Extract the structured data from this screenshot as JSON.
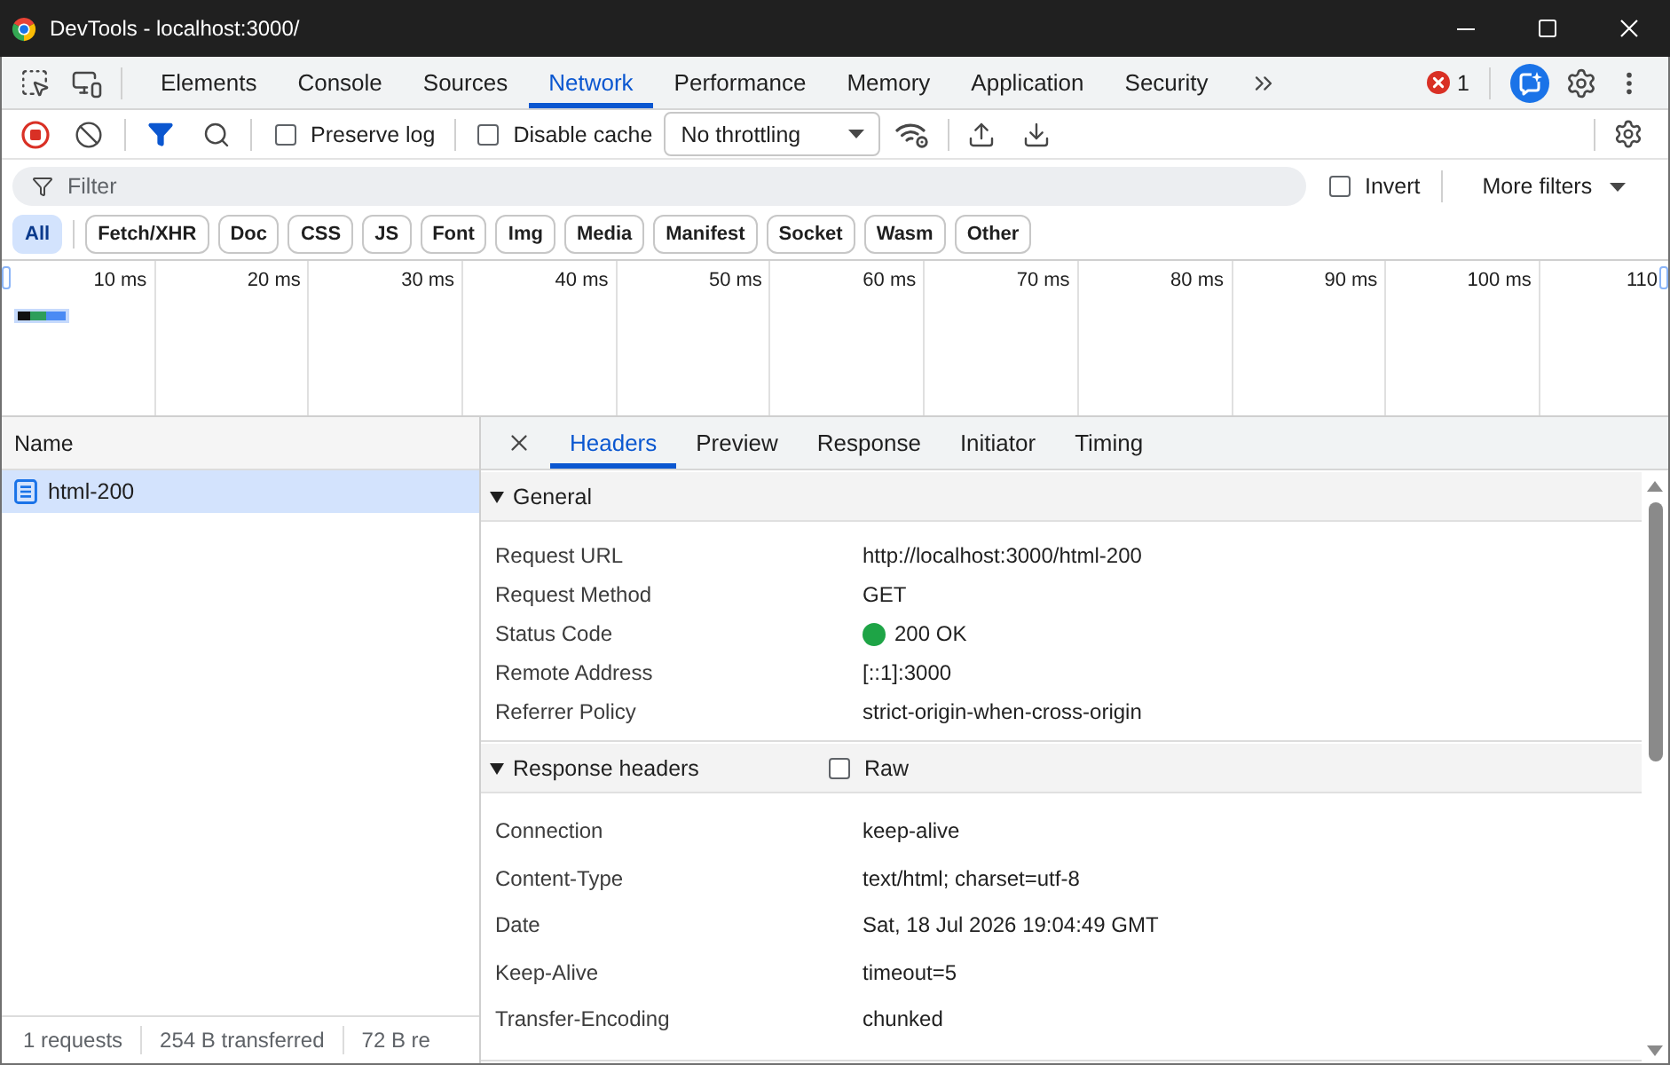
{
  "window": {
    "title": "DevTools - localhost:3000/"
  },
  "panel_tabs": [
    {
      "label": "Elements",
      "selected": false
    },
    {
      "label": "Console",
      "selected": false
    },
    {
      "label": "Sources",
      "selected": false
    },
    {
      "label": "Network",
      "selected": true
    },
    {
      "label": "Performance",
      "selected": false
    },
    {
      "label": "Memory",
      "selected": false
    },
    {
      "label": "Application",
      "selected": false
    },
    {
      "label": "Security",
      "selected": false
    }
  ],
  "error_count": "1",
  "toolbar": {
    "recording": true,
    "filter_shown": true,
    "preserve_log": {
      "label": "Preserve log",
      "checked": false
    },
    "disable_cache": {
      "label": "Disable cache",
      "checked": false
    },
    "throttling": {
      "value": "No throttling"
    }
  },
  "filter_bar": {
    "placeholder": "Filter",
    "invert": {
      "label": "Invert",
      "checked": false
    },
    "more_filters": "More filters"
  },
  "type_filters": [
    {
      "label": "All",
      "selected": true
    },
    {
      "label": "Fetch/XHR",
      "selected": false
    },
    {
      "label": "Doc",
      "selected": false
    },
    {
      "label": "CSS",
      "selected": false
    },
    {
      "label": "JS",
      "selected": false
    },
    {
      "label": "Font",
      "selected": false
    },
    {
      "label": "Img",
      "selected": false
    },
    {
      "label": "Media",
      "selected": false
    },
    {
      "label": "Manifest",
      "selected": false
    },
    {
      "label": "Socket",
      "selected": false
    },
    {
      "label": "Wasm",
      "selected": false
    },
    {
      "label": "Other",
      "selected": false
    }
  ],
  "overview": {
    "ticks": [
      "10 ms",
      "20 ms",
      "30 ms",
      "40 ms",
      "50 ms",
      "60 ms",
      "70 ms",
      "80 ms",
      "90 ms",
      "100 ms",
      "110"
    ]
  },
  "requests": {
    "column": "Name",
    "rows": [
      {
        "name": "html-200",
        "selected": true
      }
    ]
  },
  "status_bar": [
    "1 requests",
    "254 B transferred",
    "72 B re"
  ],
  "detail_tabs": [
    {
      "label": "Headers",
      "selected": true
    },
    {
      "label": "Preview",
      "selected": false
    },
    {
      "label": "Response",
      "selected": false
    },
    {
      "label": "Initiator",
      "selected": false
    },
    {
      "label": "Timing",
      "selected": false
    }
  ],
  "sections": [
    {
      "kind": "general",
      "title": "General",
      "expanded": true,
      "rows": [
        {
          "name": "Request URL",
          "value": "http://localhost:3000/html-200"
        },
        {
          "name": "Request Method",
          "value": "GET"
        },
        {
          "name": "Status Code",
          "value": "200 OK",
          "color": "#1ea446"
        },
        {
          "name": "Remote Address",
          "value": "[::1]:3000"
        },
        {
          "name": "Referrer Policy",
          "value": "strict-origin-when-cross-origin"
        }
      ]
    },
    {
      "kind": "response_headers",
      "title": "Response headers",
      "expanded": true,
      "raw": {
        "label": "Raw",
        "checked": false
      },
      "rows": [
        {
          "name": "Connection",
          "value": "keep-alive"
        },
        {
          "name": "Content-Type",
          "value": "text/html; charset=utf-8"
        },
        {
          "name": "Date",
          "value": "Sat, 18 Jul 2026 19:04:49 GMT"
        },
        {
          "name": "Keep-Alive",
          "value": "timeout=5"
        },
        {
          "name": "Transfer-Encoding",
          "value": "chunked"
        }
      ]
    }
  ]
}
